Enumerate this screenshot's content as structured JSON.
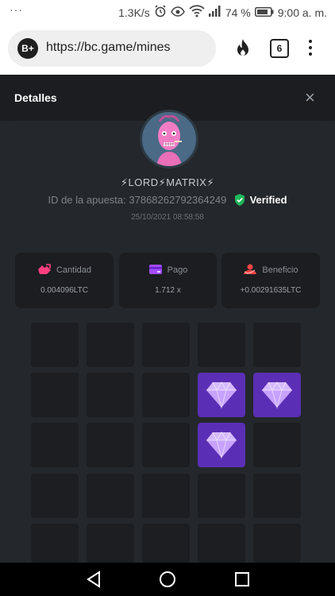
{
  "status_bar": {
    "dots": "···",
    "speed": "1.3K/s",
    "battery": "74 %",
    "time": "9:00 a. m."
  },
  "browser": {
    "site_badge": "B+",
    "url": "https://bc.game/mines",
    "tab_count": "6"
  },
  "dialog": {
    "title": "Detalles",
    "close": "×"
  },
  "bet": {
    "username": "⚡LORD⚡MATRIX⚡",
    "id_label": "ID de la apuesta:",
    "id_value": "37868262792364249",
    "verified": "Verified",
    "datetime": "25/10/2021 08:58:58"
  },
  "stats": [
    {
      "label": "Cantidad",
      "value": "0.004096LTC",
      "icon": "wallet-send-icon",
      "color": "#ff3e7f"
    },
    {
      "label": "Pago",
      "value": "1.712 x",
      "icon": "card-icon",
      "color": "#a24bff"
    },
    {
      "label": "Beneficio",
      "value": "+0.00291635LTC",
      "icon": "profit-icon",
      "color": "#ff4545"
    }
  ],
  "grid": {
    "rows": [
      [
        "empty",
        "empty",
        "empty",
        "empty",
        "empty"
      ],
      [
        "empty",
        "empty",
        "empty",
        "gem",
        "gem"
      ],
      [
        "empty",
        "empty",
        "empty",
        "gem",
        "empty"
      ],
      [
        "empty",
        "empty",
        "empty",
        "empty",
        "empty"
      ],
      [
        "empty",
        "empty",
        "empty",
        "empty",
        "empty"
      ]
    ],
    "gem_color": "#c8a2ff",
    "tile_color": "#1c1e21",
    "gem_tile_color": "#5b2fb5"
  },
  "nav": {
    "back": "back-icon",
    "home": "home-icon",
    "recents": "recents-icon"
  }
}
